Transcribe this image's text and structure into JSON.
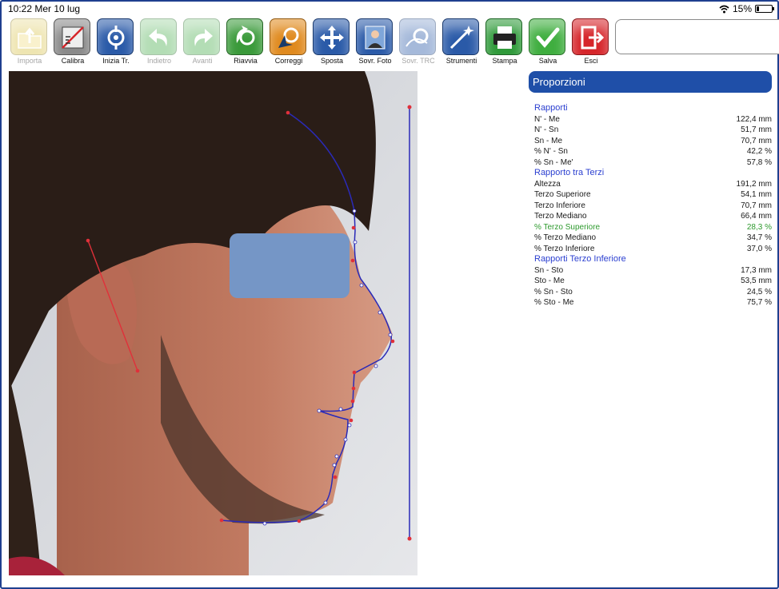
{
  "status": {
    "time": "10:22",
    "date": "Mer 10 lug",
    "battery": "15%",
    "battery_level": 0.15
  },
  "toolbar": [
    {
      "label": "Importa",
      "icon": "import-folder-icon",
      "color": "#d9c247",
      "disabled": true
    },
    {
      "label": "Calibra",
      "icon": "calibrate-ruler-icon",
      "color": "#8a8a8a",
      "disabled": false
    },
    {
      "label": "Inizia Tr.",
      "icon": "start-tracing-icon",
      "color": "#2a5aa8",
      "disabled": false
    },
    {
      "label": "Indietro",
      "icon": "undo-arrow-icon",
      "color": "#4caf50",
      "disabled": true
    },
    {
      "label": "Avanti",
      "icon": "redo-arrow-icon",
      "color": "#4caf50",
      "disabled": true
    },
    {
      "label": "Riavvia",
      "icon": "restart-icon",
      "color": "#3a9a3a",
      "disabled": false
    },
    {
      "label": "Correggi",
      "icon": "correct-cursor-icon",
      "color": "#e08a1e",
      "disabled": false
    },
    {
      "label": "Sposta",
      "icon": "move-arrows-icon",
      "color": "#2a5aa8",
      "disabled": false
    },
    {
      "label": "Sovr. Foto",
      "icon": "overlay-photo-icon",
      "color": "#2a5aa8",
      "disabled": false
    },
    {
      "label": "Sovr. TRC",
      "icon": "overlay-trc-icon",
      "color": "#2a5aa8",
      "disabled": true
    },
    {
      "label": "Strumenti",
      "icon": "tools-wand-icon",
      "color": "#2a5aa8",
      "disabled": false
    },
    {
      "label": "Stampa",
      "icon": "printer-icon",
      "color": "#2f9a3a",
      "disabled": false
    },
    {
      "label": "Salva",
      "icon": "save-check-icon",
      "color": "#3fae3f",
      "disabled": false
    },
    {
      "label": "Esci",
      "icon": "exit-door-icon",
      "color": "#d6252a",
      "disabled": false
    }
  ],
  "notes_field": {
    "value": ""
  },
  "panel": {
    "title": "Proporzioni",
    "sections": [
      {
        "title": "Rapporti",
        "rows": [
          {
            "label": "N' - Me",
            "value": "122,4 mm"
          },
          {
            "label": "N' - Sn",
            "value": "51,7 mm"
          },
          {
            "label": "Sn - Me",
            "value": "70,7 mm"
          },
          {
            "label": "% N' - Sn",
            "value": "42,2 %"
          },
          {
            "label": "% Sn - Me'",
            "value": "57,8 %"
          }
        ]
      },
      {
        "title": "Rapporto tra Terzi",
        "rows": [
          {
            "label": "Altezza",
            "value": "191,2 mm"
          },
          {
            "label": "Terzo Superiore",
            "value": "54,1 mm"
          },
          {
            "label": "Terzo Inferiore",
            "value": "70,7 mm"
          },
          {
            "label": "Terzo Mediano",
            "value": "66,4 mm"
          },
          {
            "label": "% Terzo Superiore",
            "value": "28,3 %",
            "highlight": true
          },
          {
            "label": "% Terzo Mediano",
            "value": "34,7 %"
          },
          {
            "label": "% Terzo Inferiore",
            "value": "37,0 %"
          }
        ]
      },
      {
        "title": "Rapporti Terzo Inferiore",
        "rows": [
          {
            "label": "Sn - Sto",
            "value": "17,3 mm"
          },
          {
            "label": "Sto - Me",
            "value": "53,5 mm"
          },
          {
            "label": "% Sn - Sto",
            "value": "24,5 %"
          },
          {
            "label": "% Sto - Me",
            "value": "75,7 %"
          }
        ]
      }
    ]
  },
  "colors": {
    "accent": "#1f4fa8",
    "section_title": "#2b3fd0",
    "highlight": "#2e9a2e",
    "trace_line": "#2a2ab8",
    "trace_point_red": "#e0303a"
  }
}
